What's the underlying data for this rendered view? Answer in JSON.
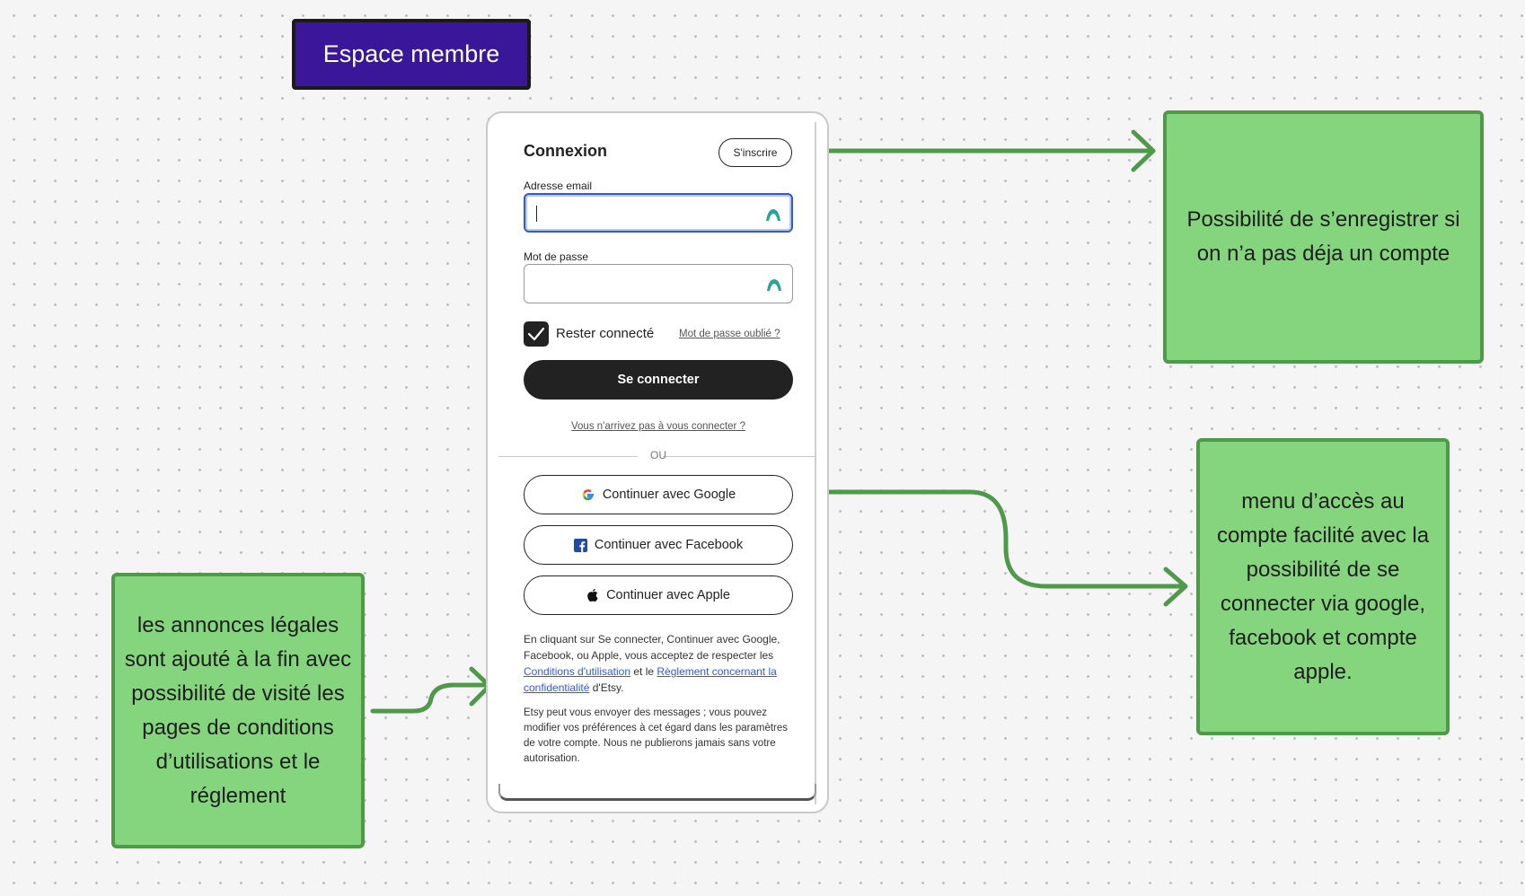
{
  "page_title": "Espace membre",
  "login": {
    "title": "Connexion",
    "signup_label": "S'inscrire",
    "email_label": "Adresse email",
    "email_value": "",
    "password_label": "Mot de passe",
    "password_value": "",
    "remember_label": "Rester connecté",
    "remember_checked": true,
    "forgot_label": "Mot de passe oublié ?",
    "submit_label": "Se connecter",
    "trouble_label": "Vous n'arrivez pas à vous connecter ?",
    "or_label": "OU",
    "google_label": "Continuer avec Google",
    "facebook_label": "Continuer avec Facebook",
    "apple_label": "Continuer avec Apple",
    "legal": {
      "part1": "En cliquant sur Se connecter, Continuer avec Google, Facebook, ou Apple, vous acceptez de respecter les ",
      "terms_link": "Conditions d'utilisation",
      "part2": " et le ",
      "privacy_link": "Règlement concernant la confidentialité",
      "part3": " d'Etsy."
    },
    "messages_note": "Etsy peut vous envoyer des messages ; vous pouvez modifier vos préférences à cet égard dans les paramètres de votre compte. Nous ne publierons jamais sans votre autorisation."
  },
  "annotations": {
    "signup_note": "Possibilité de s’enregistrer si on n’a pas déja un compte",
    "social_note": "menu d’accès au compte facilité avec la possibilité de se connecter via google, facebook et compte apple.",
    "legal_note": "les annonces légales sont ajouté à la fin avec possibilité de visité les pages de conditions d’utilisations et le réglement"
  },
  "colors": {
    "title_block": "#3a1799",
    "note_fill": "#85d57f",
    "note_border": "#4e9a4a",
    "arrow": "#4e9a4a",
    "primary_button": "#222222",
    "link": "#2f5bd6"
  }
}
